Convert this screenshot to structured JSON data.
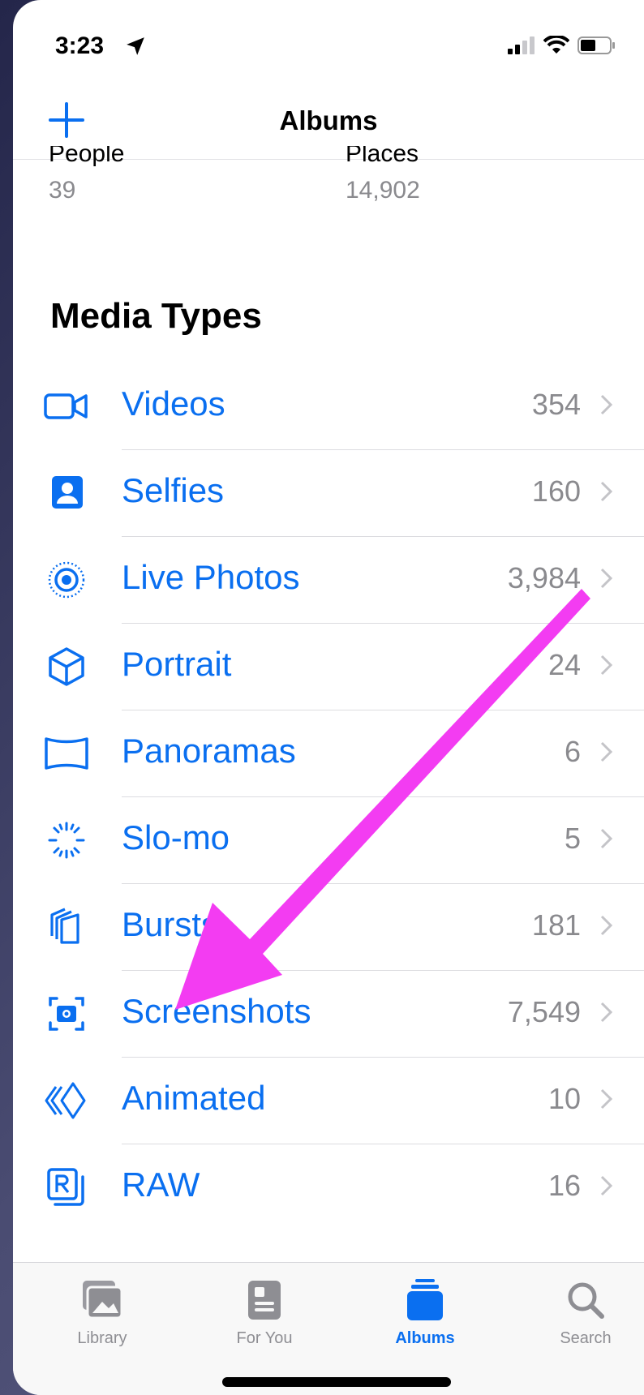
{
  "status": {
    "time": "3:23"
  },
  "nav": {
    "title": "Albums"
  },
  "people": {
    "label": "People",
    "count": "39"
  },
  "places": {
    "label": "Places",
    "count": "14,902"
  },
  "section": {
    "title": "Media Types"
  },
  "media": [
    {
      "label": "Videos",
      "count": "354",
      "icon": "video-icon"
    },
    {
      "label": "Selfies",
      "count": "160",
      "icon": "selfie-icon"
    },
    {
      "label": "Live Photos",
      "count": "3,984",
      "icon": "live-photo-icon"
    },
    {
      "label": "Portrait",
      "count": "24",
      "icon": "cube-icon"
    },
    {
      "label": "Panoramas",
      "count": "6",
      "icon": "panorama-icon"
    },
    {
      "label": "Slo-mo",
      "count": "5",
      "icon": "slomo-icon"
    },
    {
      "label": "Bursts",
      "count": "181",
      "icon": "bursts-icon"
    },
    {
      "label": "Screenshots",
      "count": "7,549",
      "icon": "screenshot-icon"
    },
    {
      "label": "Animated",
      "count": "10",
      "icon": "animated-icon"
    },
    {
      "label": "RAW",
      "count": "16",
      "icon": "raw-icon"
    }
  ],
  "tabs": [
    {
      "label": "Library",
      "icon": "library-icon"
    },
    {
      "label": "For You",
      "icon": "for-you-icon"
    },
    {
      "label": "Albums",
      "icon": "albums-icon",
      "active": true
    },
    {
      "label": "Search",
      "icon": "search-icon"
    }
  ],
  "colors": {
    "accent": "#0a6ff0",
    "annotation": "#f33cf2",
    "secondary": "#8a8a8e"
  }
}
